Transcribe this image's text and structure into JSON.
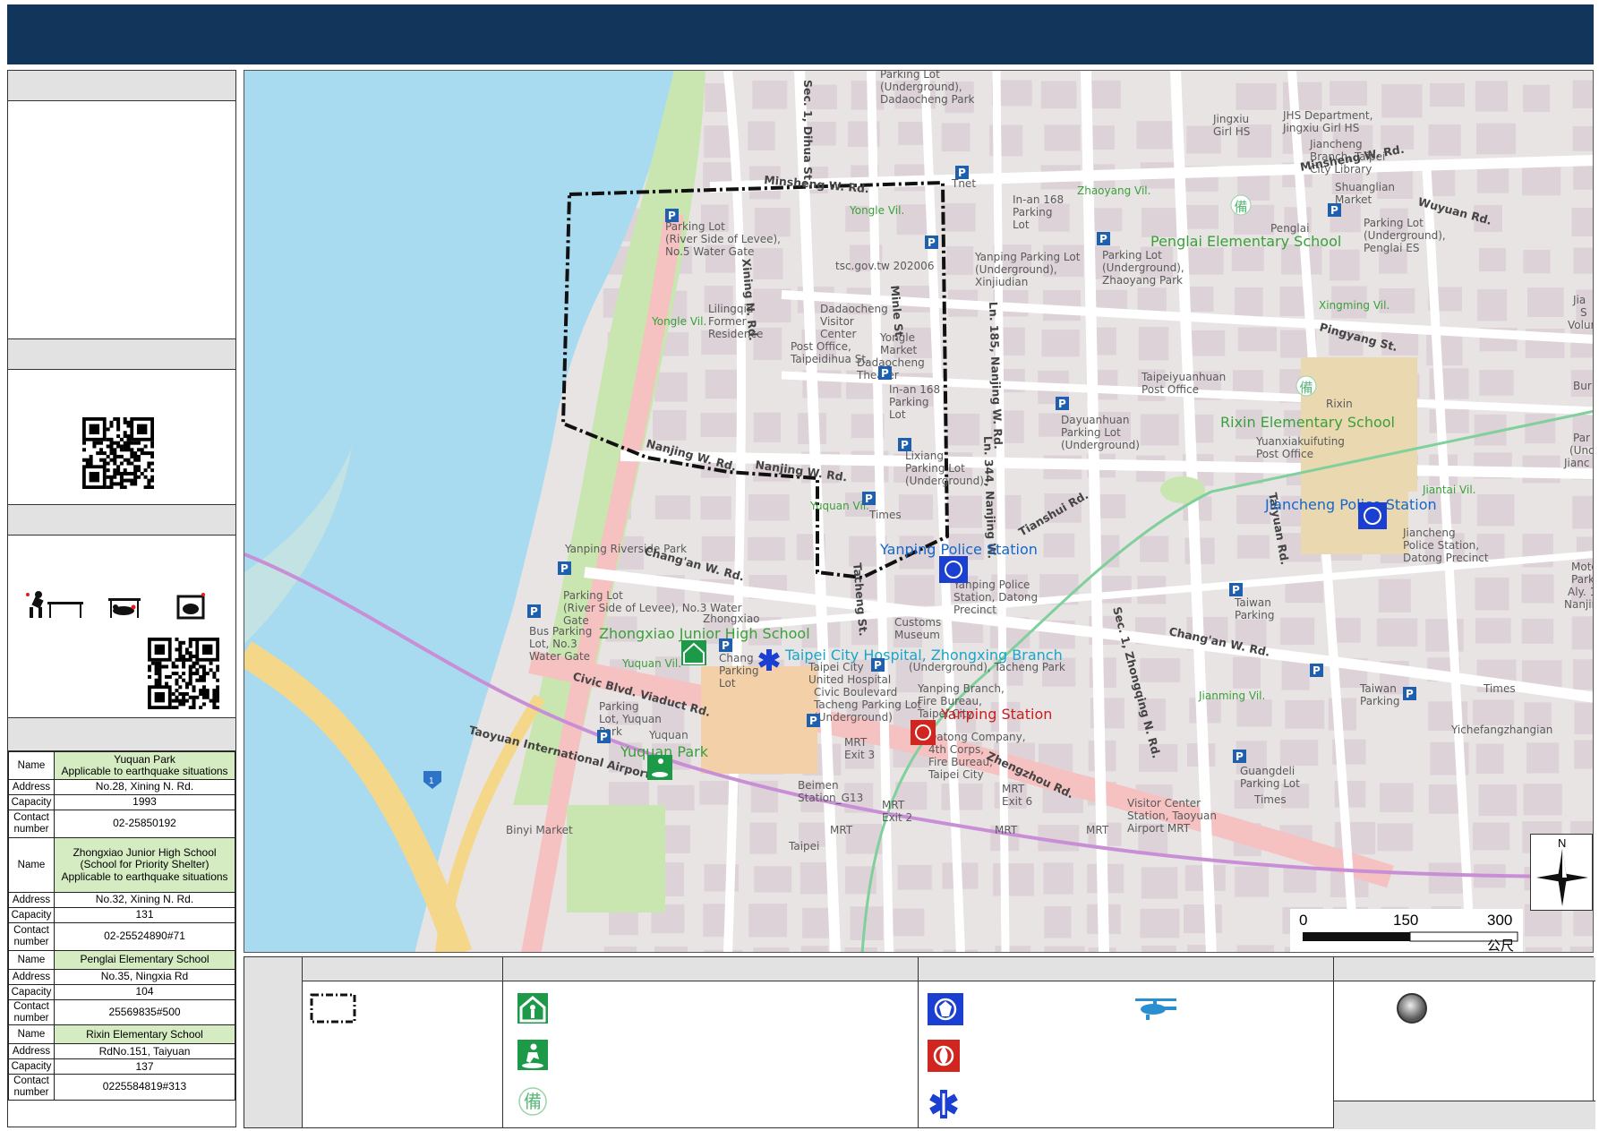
{
  "map": {
    "places": {
      "pk_dadaocheng": "Parking Lot\n(Underground),\nDadaocheng Park",
      "jingxiu": "Jingxiu\nGirl HS",
      "jhs_dept": "JHS Department,\nJingxiu Girl HS",
      "jiancheng_lib": "Jiancheng\nBranch, Taipei\nCity Library",
      "tnet": "Tnet",
      "inan_pk1": "In-an 168\nParking\nLot",
      "zhaoyang_vil": "Zhaoyang Vil.",
      "shuanglian": "Shuanglian\nMarket",
      "penglai": "Penglai",
      "pk_penglai": "Parking Lot\n(Underground),\nPenglai ES",
      "pk_levee5": "Parking Lot\n(River Side of Levee),\nNo.5 Water Gate",
      "yongle_vil": "Yongle Vil.",
      "yanping_pk": "Yanping Parking Lot\n(Underground),\nXinjiudian",
      "pk_zhaoyang": "Parking Lot\n(Underground),\nZhaoyang Park",
      "watermark": "tsc.gov.tw 202006",
      "xingming_vil": "Xingming Vil.",
      "yongle_vil2": "Yongle Vil.",
      "lilingqiu": "Lilingqiu\nFormer\nResidence",
      "dadaocheng_vc": "Dadaocheng\nVisitor\nCenter",
      "post_dihua": "Post Office,\nTaipeidihua St.",
      "yongle_market": "Yongle\nMarket",
      "dadaocheng_theater": "Dadaocheng\nTheater",
      "inan_pk2": "In-an 168\nParking\nLot",
      "taipeiyuanhuan": "Taipeiyuanhuan\nPost Office",
      "rixin": "Rixin",
      "dayuanhuan_pk": "Dayuanhuan\nParking Lot\n(Underground)",
      "yuanxiakuifuting": "Yuanxiakuifuting\nPost Office",
      "lixiang_pk": "Lixiang\nParking Lot\n(Underground)",
      "yuquan_vil": "Yuquan Vil.",
      "times": "Times",
      "jiantai_vil": "Jiantai Vil.",
      "jiancheng_ps_sub": "Jiancheng\nPolice Station,\nDatong Precinct",
      "yanping_riverside": "Yanping Riverside Park",
      "yanping_ps_sub": "Yanping Police\nStation, Datong\nPrecinct",
      "pk_levee3": "Parking Lot\n(River Side of Levee), No.3 Water\nGate",
      "taiwan_pk": "Taiwan\nParking",
      "zhongxiao_sub": "Zhongxiao",
      "bus_pk": "Bus Parking\nLot, No.3\nWater Gate",
      "customs": "Customs\nMuseum",
      "yuquan_vil2": "Yuquan Vil.",
      "chang_pk": "Chang\nParking\nLot",
      "united_hosp": "Taipei City\nUnited Hospital",
      "tacheng_pk": "(Underground), Tacheng Park",
      "civic_pk": "Civic Boulevard\nTacheng Parking Lot\n(Underground)",
      "yanping_fire": "Yanping Branch,\nFire Bureau,\nTaipei City",
      "jianming_vil": "Jianming Vil.",
      "taiwan_pk2": "Taiwan\nParking",
      "times2": "Times",
      "yichefang": "Yichefangzhangian",
      "pk_yuquan": "Parking\nLot, Yuquan\nPark",
      "yuquan_small": "Yuquan",
      "datong_fire": "Datong Company,\n4th Corps,\nFire Bureau,\nTaipei City",
      "mrt3": "MRT\nExit 3",
      "beimen": "Beimen\nStation_G13",
      "mrt2": "MRT\nExit 2",
      "mrt6": "MRT\nExit 6",
      "guangdeli": "Guangdeli\nParking Lot",
      "times3": "Times",
      "visitor_center": "Visitor Center\nStation, Taoyuan\nAirport MRT",
      "binyi": "Binyi Market",
      "taipei_small": "Taipei",
      "mrt_a": "MRT",
      "mrt_b": "MRT",
      "mrt_c": "MRT",
      "jia": "Jia",
      "s_edge": "S",
      "volun": "Volun",
      "bur": "Bur",
      "par": "Par",
      "und": "(Und",
      "jianc": "Jianc",
      "moto": "Moto",
      "park_e": "Park",
      "aly": "Aly. 1",
      "nanjin": "Nanjin"
    },
    "roads": {
      "dihua": "Sec. 1, Dihua St.",
      "minsheng1": "Minsheng W. Rd.",
      "minsheng2": "Minsheng W. Rd.",
      "wuyuan": "Wuyuan Rd.",
      "xining": "Xining N. Rd.",
      "minle": "Minle St.",
      "ln185": "Ln. 185, Nanjing W. Rd.",
      "ln344": "Ln. 344, Nanjing W.",
      "pingyang": "Pingyang St.",
      "nanjing1": "Nanjing W. Rd.",
      "nanjing2": "Nanjing W. Rd.",
      "tianshui": "Tianshui Rd.",
      "taiyuan": "Taiyuan Rd.",
      "changan1": "Chang'an W. Rd.",
      "changan2": "Chang'an W. Rd.",
      "tacheng": "Tacheng St.",
      "zhongqing": "Sec. 1, Zhongqing N. Rd.",
      "civic": "Civic Blvd. Viaduct Rd.",
      "taoyuan": "Taoyuan International Airport",
      "zhengzhou": "Zhengzhou Rd."
    },
    "featured": {
      "penglai_es": "Penglai Elementary School",
      "rixin_es": "Rixin Elementary School",
      "jiancheng_ps": "Jiancheng Police Station",
      "yanping_ps": "Yanping Police Station",
      "zhongxiao_jhs": "Zhongxiao Junior High School",
      "zhongxing_hosp": "Taipei City Hospital, Zhongxing Branch",
      "yanping_station": "Yanping Station",
      "yuquan_park": "Yuquan Park"
    },
    "scale": {
      "t0": "0",
      "t1": "150",
      "t2": "300",
      "unit": "公尺"
    },
    "north": "N",
    "highway_badge": "1",
    "backup_glyph": "備"
  },
  "shelters": [
    {
      "name_key": "Name",
      "name": "Yuquan Park\nApplicable to earthquake situations",
      "addr_key": "Address",
      "address": "No.28, Xining N. Rd.",
      "cap_key": "Capacity",
      "capacity": "1993",
      "contact_key": "Contact\nnumber",
      "contact": "02-25850192"
    },
    {
      "name_key": "Name",
      "name": "Zhongxiao Junior High School\n(School for Priority Shelter)\nApplicable to earthquake situations",
      "addr_key": "Address",
      "address": "No.32, Xining N. Rd.",
      "cap_key": "Capacity",
      "capacity": "131",
      "contact_key": "Contact\nnumber",
      "contact": "02-25524890#71"
    },
    {
      "name_key": "Name",
      "name": "Penglai Elementary School",
      "addr_key": "Address",
      "address": "No.35, Ningxia Rd",
      "cap_key": "Capacity",
      "capacity": "104",
      "contact_key": "Contact\nnumber",
      "contact": "25569835#500"
    },
    {
      "name_key": "Name",
      "name": "Rixin Elementary School",
      "addr_key": "Address",
      "address": "RdNo.151, Taiyuan",
      "cap_key": "Capacity",
      "capacity": "137",
      "contact_key": "Contact\nnumber",
      "contact": "0225584819#313"
    }
  ],
  "colors": {
    "banner": "#12355b",
    "water": "#a8daf0",
    "park": "#c9e6b0",
    "major_road": "#f6c1c1",
    "police": "#1a3fd1",
    "fire": "#d0261f",
    "medical": "#1a3fd1",
    "shelter": "#1c9a47",
    "helicopter": "#2a8fd1",
    "backup": "#5ab87a",
    "label_green": "#3aa03a",
    "label_blue": "#1667c8",
    "label_red": "#c81e1e",
    "label_cyan": "#19a6c8"
  },
  "icons": {
    "legend_boundary": "dashed-boundary-box",
    "legend_shelter_school": "indoor-shelter-icon",
    "legend_shelter_park": "outdoor-shelter-icon",
    "legend_backup": "backup-shelter-icon",
    "legend_police": "police-icon",
    "legend_fire": "fire-station-icon",
    "legend_medical": "medical-icon",
    "legend_helicopter": "helicopter-icon",
    "legend_point": "gray-point-icon",
    "qr1": "qr-code-icon",
    "qr2": "qr-code-icon",
    "duck": "drop-cover-hold-icon"
  }
}
